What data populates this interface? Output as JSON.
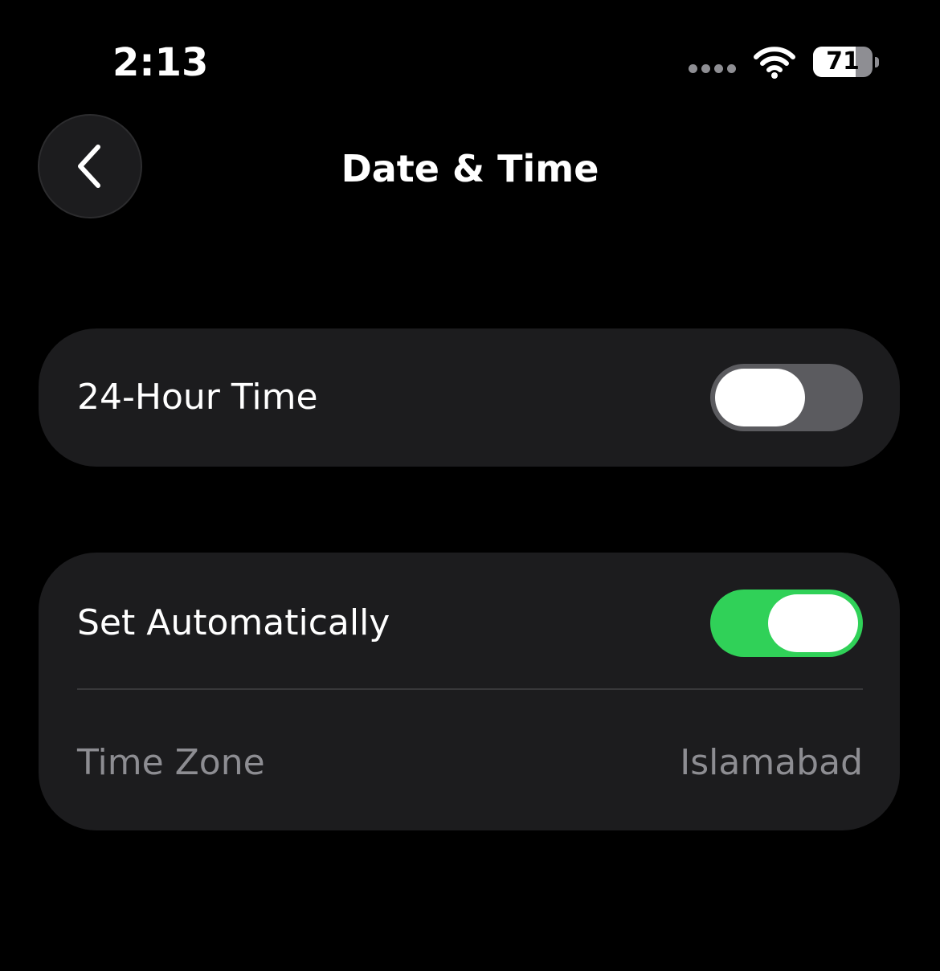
{
  "status_bar": {
    "time": "2:13",
    "battery_percent": "71",
    "battery_level": 0.71,
    "icons": [
      "cellular-dots-icon",
      "wifi-icon",
      "battery-icon"
    ]
  },
  "nav": {
    "back_icon": "chevron-left-icon",
    "title": "Date & Time"
  },
  "settings": {
    "group1": {
      "hour24": {
        "label": "24-Hour Time",
        "enabled": false
      }
    },
    "group2": {
      "set_automatically": {
        "label": "Set Automatically",
        "enabled": true
      },
      "time_zone": {
        "label": "Time Zone",
        "value": "Islamabad"
      }
    }
  },
  "colors": {
    "background": "#000000",
    "group_bg": "#1c1c1e",
    "toggle_on": "#30d158",
    "toggle_off": "#5b5b5f",
    "secondary_text": "#8d8d92"
  }
}
